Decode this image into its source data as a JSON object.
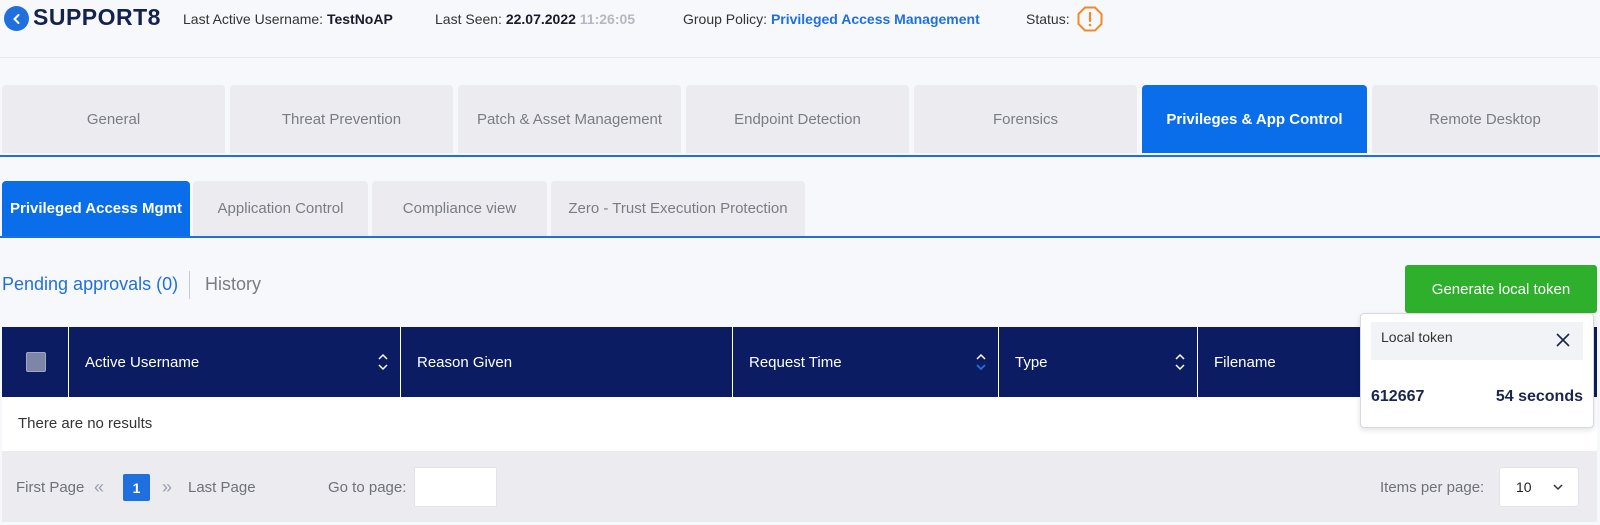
{
  "header": {
    "brand": "SUPPORT8",
    "last_active_label": "Last Active Username:",
    "last_active_value": "TestNoAP",
    "last_seen_label": "Last Seen:",
    "last_seen_date": "22.07.2022",
    "last_seen_time": "11:26:05",
    "group_policy_label": "Group Policy:",
    "group_policy_value": "Privileged Access Management",
    "status_label": "Status:",
    "status_icon": "warning-octagon-icon",
    "status_color": "#f08a2a"
  },
  "main_tabs": [
    {
      "label": "General"
    },
    {
      "label": "Threat Prevention"
    },
    {
      "label": "Patch & Asset Management"
    },
    {
      "label": "Endpoint Detection"
    },
    {
      "label": "Forensics"
    },
    {
      "label": "Privileges & App Control"
    },
    {
      "label": "Remote Desktop"
    }
  ],
  "sub_tabs": [
    {
      "label": "Privileged Access Mgmt"
    },
    {
      "label": "Application Control"
    },
    {
      "label": "Compliance view"
    },
    {
      "label": "Zero - Trust Execution Protection"
    }
  ],
  "section": {
    "pending": "Pending approvals (0)",
    "history": "History",
    "generate_button": "Generate local token"
  },
  "table": {
    "columns": [
      "Active Username",
      "Reason Given",
      "Request Time",
      "Type",
      "Filename"
    ],
    "empty": "There are no results"
  },
  "pager": {
    "first": "First Page",
    "current": "1",
    "last": "Last Page",
    "goto_label": "Go to page:",
    "goto_value": "",
    "items_label": "Items per page:",
    "items_value": "10"
  },
  "token_popup": {
    "title": "Local token",
    "code": "612667",
    "timer": "54 seconds"
  },
  "colors": {
    "accent": "#1f6fde",
    "active_tab": "#0a6eea",
    "table_header": "#0c1c63",
    "generate_button": "#2fb02c"
  }
}
